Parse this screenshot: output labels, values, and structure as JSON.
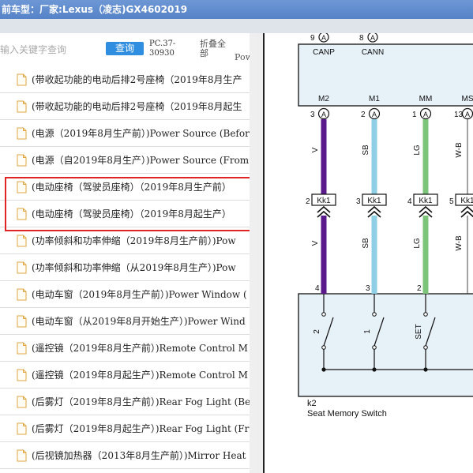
{
  "titlebar": {
    "prefix": "前车型：",
    "text": "厂家:Lexus（凌志)GX4602019"
  },
  "toolbar": {
    "search_placeholder": "输入关键字查询",
    "query_label": "查询",
    "pc_number": "PC.37-30930",
    "collapse_label": "折叠全部",
    "overflow_text": "Pow"
  },
  "list": {
    "items": [
      {
        "label": "(带收起功能的电动后排2号座椅（2019年8月生产"
      },
      {
        "label": "(带收起功能的电动后排2号座椅（2019年8月起生"
      },
      {
        "label": "(电源（2019年8月生产前）)Power Source (Before"
      },
      {
        "label": "(电源（自2019年8月生产）)Power Source (From A"
      },
      {
        "label": "(电动座椅（驾驶员座椅）（2019年8月生产前）"
      },
      {
        "label": "(电动座椅（驾驶员座椅）（2019年8月起生产）"
      },
      {
        "label": "(功率倾斜和功率伸缩（2019年8月生产前）)Pow"
      },
      {
        "label": "(功率倾斜和功率伸缩（从2019年8月生产）)Pow"
      },
      {
        "label": "(电动车窗（2019年8月生产前）)Power Window ("
      },
      {
        "label": "(电动车窗（从2019年8月开始生产）)Power Wind"
      },
      {
        "label": "(遥控镜（2019年8月生产前）)Remote Control M"
      },
      {
        "label": "(遥控镜（2019年8月起生产）)Remote Control M"
      },
      {
        "label": "(后雾灯（2019年8月生产前）)Rear Fog Light (Be"
      },
      {
        "label": "(后雾灯（2019年8月起生产）)Rear Fog Light (Fr"
      },
      {
        "label": "(后视镜加热器（2013年8月生产前）)Mirror Heat"
      }
    ]
  },
  "diagram": {
    "top_pins": [
      {
        "pin": "9",
        "letter": "A",
        "name": "CANP"
      },
      {
        "pin": "8",
        "letter": "A",
        "name": "CANN"
      }
    ],
    "wires": [
      {
        "label": "M2",
        "pin": "3",
        "letter": "A",
        "color_code": "V",
        "color": "#5b1a8c",
        "conn_pin": "2",
        "conn": "Kk1",
        "bottom_pin": "4",
        "switch_label": "2"
      },
      {
        "label": "M1",
        "pin": "2",
        "letter": "A",
        "color_code": "SB",
        "color": "#8ecfe6",
        "conn_pin": "3",
        "conn": "Kk1",
        "bottom_pin": "3",
        "switch_label": "1"
      },
      {
        "label": "MM",
        "pin": "1",
        "letter": "A",
        "color_code": "LG",
        "color": "#7cc47a",
        "conn_pin": "4",
        "conn": "Kk1",
        "bottom_pin": "2",
        "switch_label": "SET"
      },
      {
        "label": "MS",
        "pin": "13",
        "letter": "A",
        "color_code": "W-B",
        "color": "#ffffff",
        "conn_pin": "5",
        "conn": "Kk1",
        "bottom_pin": "",
        "switch_label": ""
      }
    ],
    "component_id": "k2",
    "component_name": "Seat Memory Switch"
  },
  "colors": {
    "titlebar": "#5b88cc",
    "query_button": "#2f8ee0",
    "highlight_border": "#e02424"
  }
}
